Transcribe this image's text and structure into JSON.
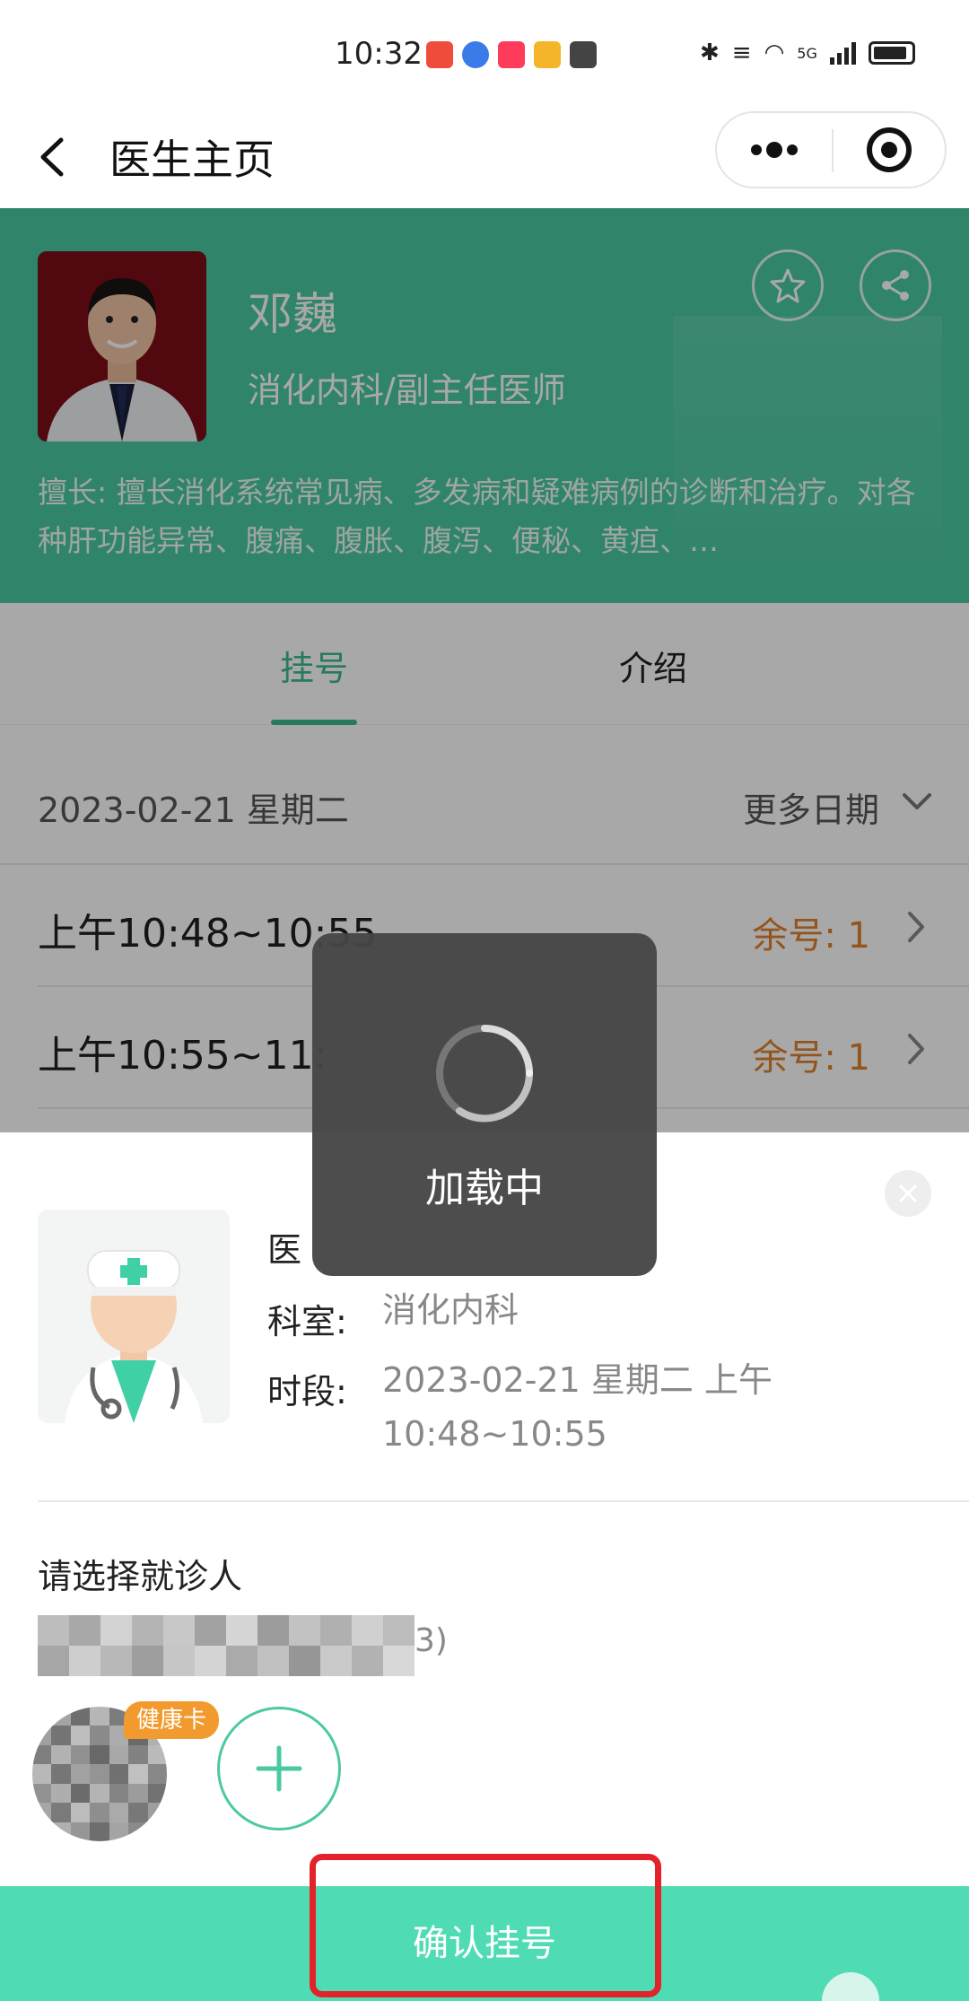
{
  "status_bar": {
    "time": "10:32",
    "network": "5G"
  },
  "nav": {
    "title": "医生主页"
  },
  "doctor": {
    "name": "邓巍",
    "department_title": "消化内科/副主任医师",
    "specialty": "擅长: 擅长消化系统常见病、多发病和疑难病例的诊断和治疗。对各种肝功能异常、腹痛、腹胀、腹泻、便秘、黄疸、…"
  },
  "tabs": [
    {
      "label": "挂号",
      "active": true
    },
    {
      "label": "介绍",
      "active": false
    }
  ],
  "schedule": {
    "date": "2023-02-21 星期二",
    "more_dates": "更多日期",
    "slots": [
      {
        "time": "上午10:48~10:55",
        "remaining": "余号: 1"
      },
      {
        "time": "上午10:55~11:",
        "remaining": "余号: 1"
      }
    ]
  },
  "sheet": {
    "doctor_label": "医",
    "dept_label": "科室:",
    "dept_value": "消化内科",
    "period_label": "时段:",
    "period_value_line1": "2023-02-21 星期二 上午",
    "period_value_line2": "10:48~10:55",
    "select_patient_label": "请选择就诊人",
    "patient_name_suffix": "3)",
    "health_card_badge": "健康卡",
    "confirm_label": "确认挂号"
  },
  "toast": {
    "text": "加载中"
  },
  "colors": {
    "brand_green": "#49c9a2",
    "tab_active": "#3db892",
    "remaining_orange": "#e0822e",
    "confirm_bar": "#4fdcb4",
    "highlight_red": "#e2232a",
    "badge_orange": "#f29a2e"
  },
  "icons": [
    "back-arrow-icon",
    "more-dots-icon",
    "close-target-icon",
    "star-icon",
    "share-icon",
    "chevron-down-icon",
    "chevron-right-icon",
    "close-icon",
    "plus-icon",
    "spinner-icon"
  ]
}
